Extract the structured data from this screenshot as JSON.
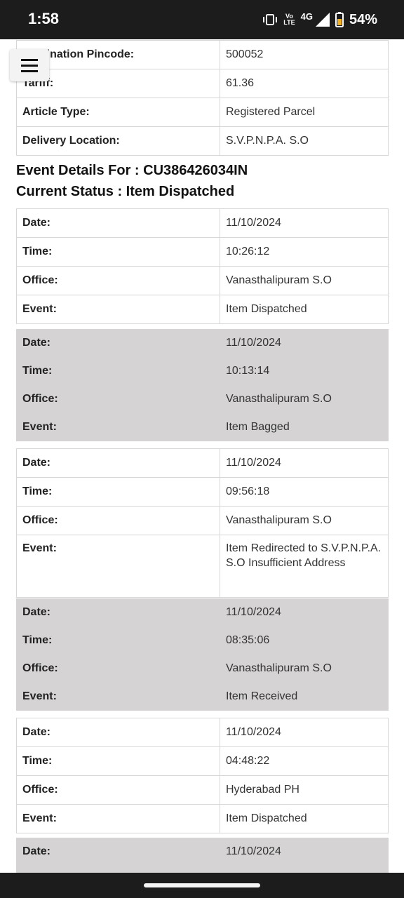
{
  "status_bar": {
    "time": "1:58",
    "volte_top": "Vo",
    "volte_bottom": "LTE",
    "network": "4G",
    "battery": "54%"
  },
  "top_table": [
    {
      "label": "Destination Pincode:",
      "value": "500052"
    },
    {
      "label": "Tariff:",
      "value": "61.36"
    },
    {
      "label": "Article Type:",
      "value": "Registered Parcel"
    },
    {
      "label": "Delivery Location:",
      "value": "S.V.P.N.P.A. S.O"
    }
  ],
  "event_heading": "Event Details For : CU386426034IN",
  "status_heading": "Current Status : Item Dispatched",
  "labels": {
    "date": "Date:",
    "time": "Time:",
    "office": "Office:",
    "event": "Event:"
  },
  "events": [
    {
      "date": "11/10/2024",
      "time": "10:26:12",
      "office": "Vanasthalipuram S.O",
      "event": "Item Dispatched"
    },
    {
      "date": "11/10/2024",
      "time": "10:13:14",
      "office": "Vanasthalipuram S.O",
      "event": "Item Bagged"
    },
    {
      "date": "11/10/2024",
      "time": "09:56:18",
      "office": "Vanasthalipuram S.O",
      "event": "Item Redirected to S.V.P.N.P.A. S.O Insufficient Address"
    },
    {
      "date": "11/10/2024",
      "time": "08:35:06",
      "office": "Vanasthalipuram S.O",
      "event": "Item Received"
    },
    {
      "date": "11/10/2024",
      "time": "04:48:22",
      "office": "Hyderabad PH",
      "event": "Item Dispatched"
    },
    {
      "date": "11/10/2024"
    }
  ],
  "icons": {
    "menu": "hamburger-menu-icon",
    "vibrate": "vibrate-icon",
    "signal": "signal-icon",
    "battery": "battery-icon"
  },
  "colors": {
    "status_bar": "#1c1c1c",
    "shaded_block": "#d5d3d3",
    "border": "#d6d6d6"
  }
}
